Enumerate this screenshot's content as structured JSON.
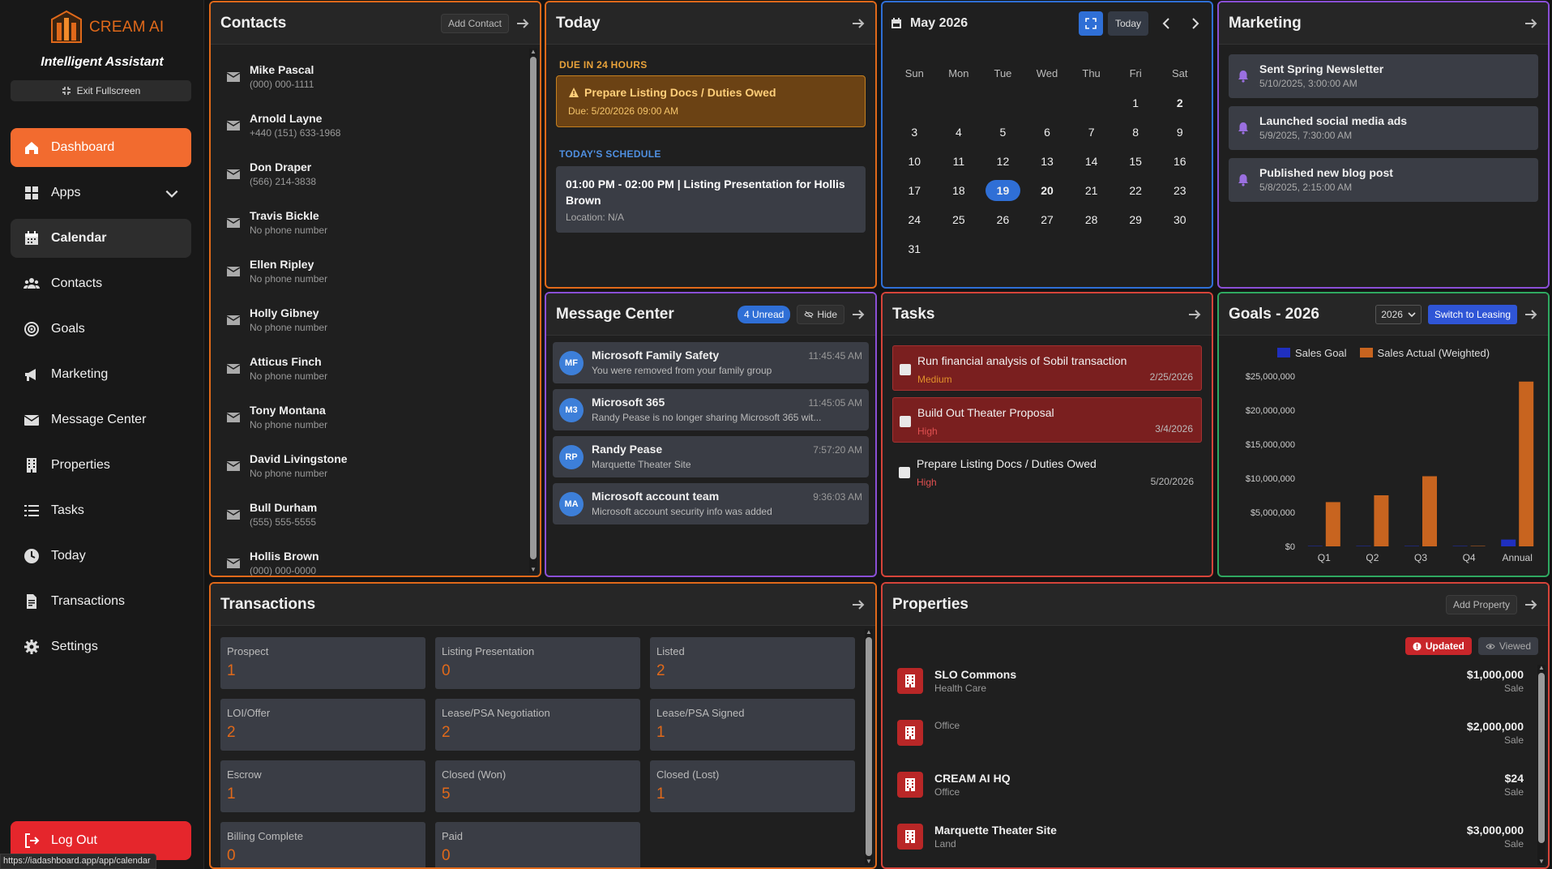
{
  "sidebar": {
    "brand": "CREAM AI",
    "tagline": "Intelligent Assistant",
    "exit_fullscreen": "Exit Fullscreen",
    "items": [
      {
        "label": "Dashboard",
        "icon": "home-icon"
      },
      {
        "label": "Apps",
        "icon": "grid-icon"
      },
      {
        "label": "Calendar",
        "icon": "calendar-icon"
      },
      {
        "label": "Contacts",
        "icon": "users-icon"
      },
      {
        "label": "Goals",
        "icon": "target-icon"
      },
      {
        "label": "Marketing",
        "icon": "megaphone-icon"
      },
      {
        "label": "Message Center",
        "icon": "envelope-icon"
      },
      {
        "label": "Properties",
        "icon": "building-icon"
      },
      {
        "label": "Tasks",
        "icon": "list-icon"
      },
      {
        "label": "Today",
        "icon": "clock-icon"
      },
      {
        "label": "Transactions",
        "icon": "document-icon"
      },
      {
        "label": "Settings",
        "icon": "gear-icon"
      }
    ],
    "logout": "Log Out",
    "status_url": "https://iadashboard.app/app/calendar"
  },
  "contacts": {
    "title": "Contacts",
    "add_label": "Add Contact",
    "items": [
      {
        "name": "Mike Pascal",
        "phone": "(000) 000-1111"
      },
      {
        "name": "Arnold Layne",
        "phone": "+440 (151) 633-1968"
      },
      {
        "name": "Don Draper",
        "phone": "(566) 214-3838"
      },
      {
        "name": "Travis Bickle",
        "phone": "No phone number"
      },
      {
        "name": "Ellen Ripley",
        "phone": "No phone number"
      },
      {
        "name": "Holly Gibney",
        "phone": "No phone number"
      },
      {
        "name": "Atticus Finch",
        "phone": "No phone number"
      },
      {
        "name": "Tony Montana",
        "phone": "No phone number"
      },
      {
        "name": "David Livingstone",
        "phone": "No phone number"
      },
      {
        "name": "Bull Durham",
        "phone": "(555) 555-5555"
      },
      {
        "name": "Hollis Brown",
        "phone": "(000) 000-0000"
      }
    ]
  },
  "today": {
    "title": "Today",
    "due_label": "DUE IN 24 HOURS",
    "due_item": "Prepare Listing Docs / Duties Owed",
    "due_date": "Due: 5/20/2026 09:00 AM",
    "schedule_label": "TODAY'S SCHEDULE",
    "schedule_item": "01:00 PM - 02:00 PM | Listing Presentation for Hollis Brown",
    "schedule_location": "Location: N/A"
  },
  "calendar": {
    "title": "May 2026",
    "today_label": "Today",
    "dow": [
      "Sun",
      "Mon",
      "Tue",
      "Wed",
      "Thu",
      "Fri",
      "Sat"
    ],
    "weeks": [
      [
        "",
        "",
        "",
        "",
        "",
        "1",
        "2"
      ],
      [
        "3",
        "4",
        "5",
        "6",
        "7",
        "8",
        "9"
      ],
      [
        "10",
        "11",
        "12",
        "13",
        "14",
        "15",
        "16"
      ],
      [
        "17",
        "18",
        "19",
        "20",
        "21",
        "22",
        "23"
      ],
      [
        "24",
        "25",
        "26",
        "27",
        "28",
        "29",
        "30"
      ],
      [
        "31",
        "",
        "",
        "",
        "",
        "",
        ""
      ]
    ],
    "selected": "19",
    "bold_days": [
      "2",
      "20"
    ]
  },
  "marketing": {
    "title": "Marketing",
    "items": [
      {
        "title": "Sent Spring Newsletter",
        "date": "5/10/2025, 3:00:00 AM"
      },
      {
        "title": "Launched social media ads",
        "date": "5/9/2025, 7:30:00 AM"
      },
      {
        "title": "Published new blog post",
        "date": "5/8/2025, 2:15:00 AM"
      }
    ]
  },
  "messages": {
    "title": "Message Center",
    "unread": "4 Unread",
    "hide": "Hide",
    "items": [
      {
        "initials": "MF",
        "from": "Microsoft Family Safety",
        "body": "You were removed from your family group",
        "time": "11:45:45 AM"
      },
      {
        "initials": "M3",
        "from": "Microsoft 365",
        "body": "Randy Pease is no longer sharing Microsoft 365 wit...",
        "time": "11:45:05 AM"
      },
      {
        "initials": "RP",
        "from": "Randy Pease",
        "body": "Marquette Theater Site",
        "time": "7:57:20 AM"
      },
      {
        "initials": "MA",
        "from": "Microsoft account team",
        "body": "Microsoft account security info was added",
        "time": "9:36:03 AM"
      }
    ]
  },
  "tasks": {
    "title": "Tasks",
    "items": [
      {
        "title": "Run financial analysis of Sobil transaction",
        "priority": "Medium",
        "date": "2/25/2026",
        "highlight": true
      },
      {
        "title": "Build Out Theater Proposal",
        "priority": "High",
        "date": "3/4/2026",
        "highlight": true
      },
      {
        "title": "Prepare Listing Docs / Duties Owed",
        "priority": "High",
        "date": "5/20/2026",
        "highlight": false
      }
    ]
  },
  "goals": {
    "title": "Goals - 2026",
    "year": "2026",
    "switch_label": "Switch to Leasing"
  },
  "chart_data": {
    "type": "bar",
    "categories": [
      "Q1",
      "Q2",
      "Q3",
      "Q4",
      "Annual"
    ],
    "series": [
      {
        "name": "Sales Goal",
        "color": "#1f2fbf",
        "values": [
          0,
          0,
          0,
          0,
          1000000
        ]
      },
      {
        "name": "Sales Actual (Weighted)",
        "color": "#c8641f",
        "values": [
          6500000,
          7500000,
          10300000,
          0,
          24200000
        ]
      }
    ],
    "ylim": [
      0,
      25000000
    ],
    "yticks": [
      "$0",
      "$5,000,000",
      "$10,000,000",
      "$15,000,000",
      "$20,000,000",
      "$25,000,000"
    ],
    "legend": "top",
    "grid": false
  },
  "transactions": {
    "title": "Transactions",
    "cards": [
      {
        "label": "Prospect",
        "value": "1"
      },
      {
        "label": "Listing Presentation",
        "value": "0"
      },
      {
        "label": "Listed",
        "value": "2"
      },
      {
        "label": "LOI/Offer",
        "value": "2"
      },
      {
        "label": "Lease/PSA Negotiation",
        "value": "2"
      },
      {
        "label": "Lease/PSA Signed",
        "value": "1"
      },
      {
        "label": "Escrow",
        "value": "1"
      },
      {
        "label": "Closed (Won)",
        "value": "5"
      },
      {
        "label": "Closed (Lost)",
        "value": "1"
      },
      {
        "label": "Billing Complete",
        "value": "0"
      },
      {
        "label": "Paid",
        "value": "0"
      }
    ]
  },
  "properties": {
    "title": "Properties",
    "add_label": "Add Property",
    "updated": "Updated",
    "viewed": "Viewed",
    "items": [
      {
        "name": "SLO Commons",
        "type": "Health Care",
        "price": "$1,000,000",
        "kind": "Sale"
      },
      {
        "name": "",
        "type": "Office",
        "price": "$2,000,000",
        "kind": "Sale"
      },
      {
        "name": "CREAM AI HQ",
        "type": "Office",
        "price": "$24",
        "kind": "Sale"
      },
      {
        "name": "Marquette Theater Site",
        "type": "Land",
        "price": "$3,000,000",
        "kind": "Sale"
      }
    ]
  }
}
